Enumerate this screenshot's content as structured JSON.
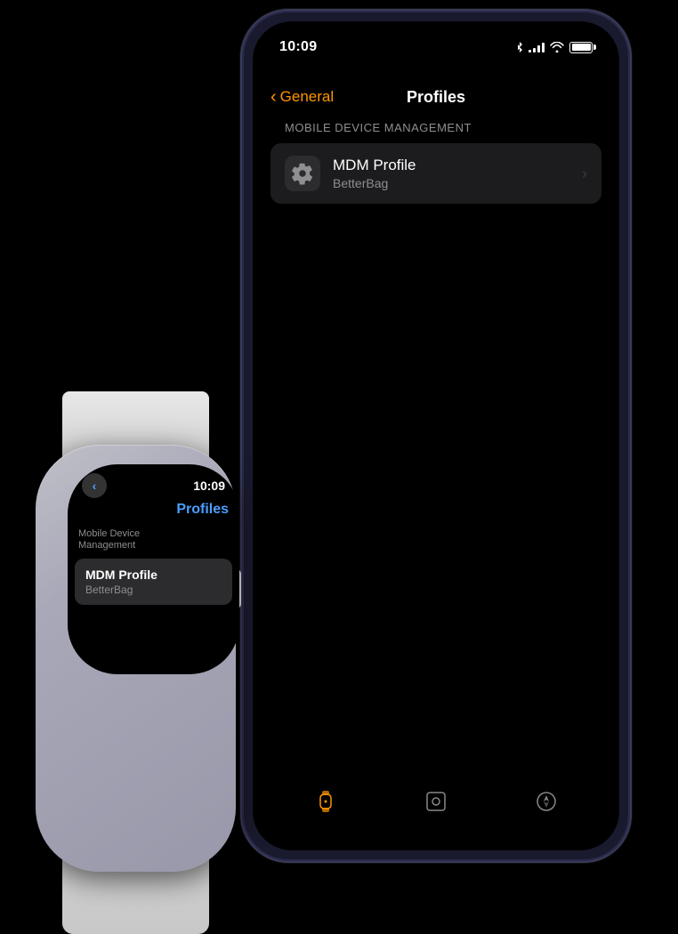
{
  "iphone": {
    "status_bar": {
      "time": "10:09",
      "signal_bars": [
        4,
        6,
        8,
        10,
        12
      ],
      "wifi_symbol": "wifi",
      "battery_level": "full"
    },
    "nav": {
      "back_label": "General",
      "title": "Profiles"
    },
    "content": {
      "section_label": "MOBILE DEVICE MANAGEMENT",
      "profile": {
        "name": "MDM Profile",
        "subtitle": "BetterBag"
      }
    },
    "tab_bar": {
      "icons": [
        "watch-icon",
        "archive-icon",
        "compass-icon"
      ]
    }
  },
  "watch": {
    "status_bar": {
      "back_symbol": "<",
      "time": "10:09"
    },
    "title": "Profiles",
    "section_label": "Mobile Device\nManagement",
    "profile": {
      "name": "MDM Profile",
      "subtitle": "BetterBag"
    }
  }
}
